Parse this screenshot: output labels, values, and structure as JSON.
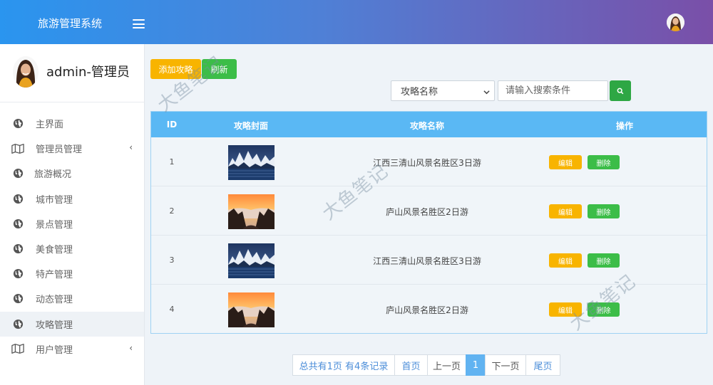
{
  "header": {
    "title": "旅游管理系统"
  },
  "sidebar": {
    "user_name": "admin-管理员",
    "items": [
      {
        "label": "主界面",
        "icon": "globe-icon",
        "arrow": ""
      },
      {
        "label": "管理员管理",
        "icon": "map-icon",
        "arrow": "‹"
      },
      {
        "label": "旅游概况",
        "icon": "globe-icon",
        "arrow": ""
      },
      {
        "label": "城市管理",
        "icon": "globe-icon",
        "arrow": ""
      },
      {
        "label": "景点管理",
        "icon": "globe-icon",
        "arrow": ""
      },
      {
        "label": "美食管理",
        "icon": "globe-icon",
        "arrow": ""
      },
      {
        "label": "特产管理",
        "icon": "globe-icon",
        "arrow": ""
      },
      {
        "label": "动态管理",
        "icon": "globe-icon",
        "arrow": ""
      },
      {
        "label": "攻略管理",
        "icon": "globe-icon",
        "arrow": "",
        "active": true
      },
      {
        "label": "用户管理",
        "icon": "map-icon",
        "arrow": "‹"
      }
    ]
  },
  "toolbar": {
    "add_label": "添加攻略",
    "refresh_label": "刷新"
  },
  "search": {
    "select_value": "攻略名称",
    "placeholder": "请输入搜索条件"
  },
  "table": {
    "headers": [
      "ID",
      "攻略封面",
      "攻略名称",
      "操作"
    ],
    "rows": [
      {
        "id": "1",
        "name": "江西三清山风景名胜区3日游",
        "cover": "snowy-mountain-lake"
      },
      {
        "id": "2",
        "name": "庐山风景名胜区2日游",
        "cover": "sunset-sea-of-clouds"
      },
      {
        "id": "3",
        "name": "江西三清山风景名胜区3日游",
        "cover": "snowy-mountain-lake"
      },
      {
        "id": "4",
        "name": "庐山风景名胜区2日游",
        "cover": "sunset-sea-of-clouds"
      }
    ],
    "edit_label": "编辑",
    "delete_label": "删除"
  },
  "pagination": {
    "summary": "总共有1页  有4条记录",
    "first": "首页",
    "prev": "上一页",
    "current": "1",
    "next": "下一页",
    "last": "尾页"
  },
  "watermark": "大鱼笔记",
  "colors": {
    "accent": "#5ab8f4",
    "warning": "#f8b400",
    "success": "#3cbd48"
  }
}
